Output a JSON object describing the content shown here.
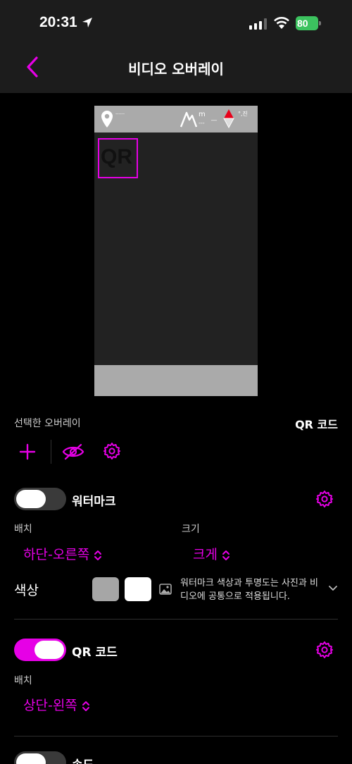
{
  "status": {
    "time": "20:31",
    "battery": "80"
  },
  "nav": {
    "title": "비디오 오버레이"
  },
  "preview": {
    "qr_text": "QR",
    "pin_text": "------",
    "alt_unit": "m",
    "alt_dash": "---",
    "alt_dash2": "__",
    "compass_text": "°,진"
  },
  "selected": {
    "label": "선택한 오버레이",
    "value": "QR 코드"
  },
  "watermark": {
    "label": "워터마크",
    "enabled": false,
    "placement_label": "배치",
    "placement_value": "하단-오른쪽",
    "size_label": "크기",
    "size_value": "크게",
    "color_label": "색상",
    "swatch_colors": [
      "#a6a6a6",
      "#ffffff"
    ],
    "color_desc": "워터마크 색상과 투명도는 사진과 비디오에 공통으로 적용됩니다."
  },
  "qr": {
    "label": "QR 코드",
    "enabled": true,
    "placement_label": "배치",
    "placement_value": "상단-왼쪽"
  },
  "speed": {
    "label": "속도",
    "enabled": false
  },
  "colors": {
    "accent": "#e600e6",
    "toggle_off": "#3a3a3a"
  }
}
